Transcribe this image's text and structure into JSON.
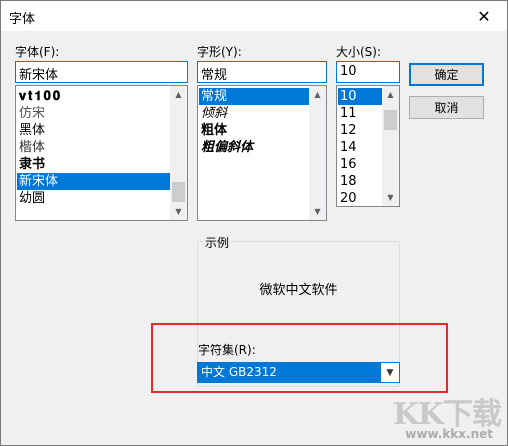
{
  "window": {
    "title": "字体",
    "close_glyph": "✕"
  },
  "font_name": {
    "label": "字体(F):",
    "value": "新宋体",
    "items": [
      "𝐯𝐭𝟏𝟎𝟎",
      "仿宋",
      "黑体",
      "楷体",
      "隶书",
      "新宋体",
      "幼圆"
    ],
    "selected_index": 5
  },
  "font_style": {
    "label": "字形(Y):",
    "value": "常规",
    "items": [
      "常规",
      "倾斜",
      "粗体",
      "粗偏斜体"
    ],
    "selected_index": 0
  },
  "font_size": {
    "label": "大小(S):",
    "value": "10",
    "items": [
      "10",
      "11",
      "12",
      "14",
      "16",
      "18",
      "20"
    ],
    "selected_index": 0
  },
  "buttons": {
    "ok": "确定",
    "cancel": "取消"
  },
  "sample": {
    "legend": "示例",
    "text": "微软中文软件"
  },
  "charset": {
    "label": "字符集(R):",
    "value": "中文 GB2312"
  },
  "watermark": {
    "logo": "KK下载",
    "url": "www.kkx.net"
  },
  "colors": {
    "accent": "#0078d7",
    "highlight": "#e12a2a"
  }
}
